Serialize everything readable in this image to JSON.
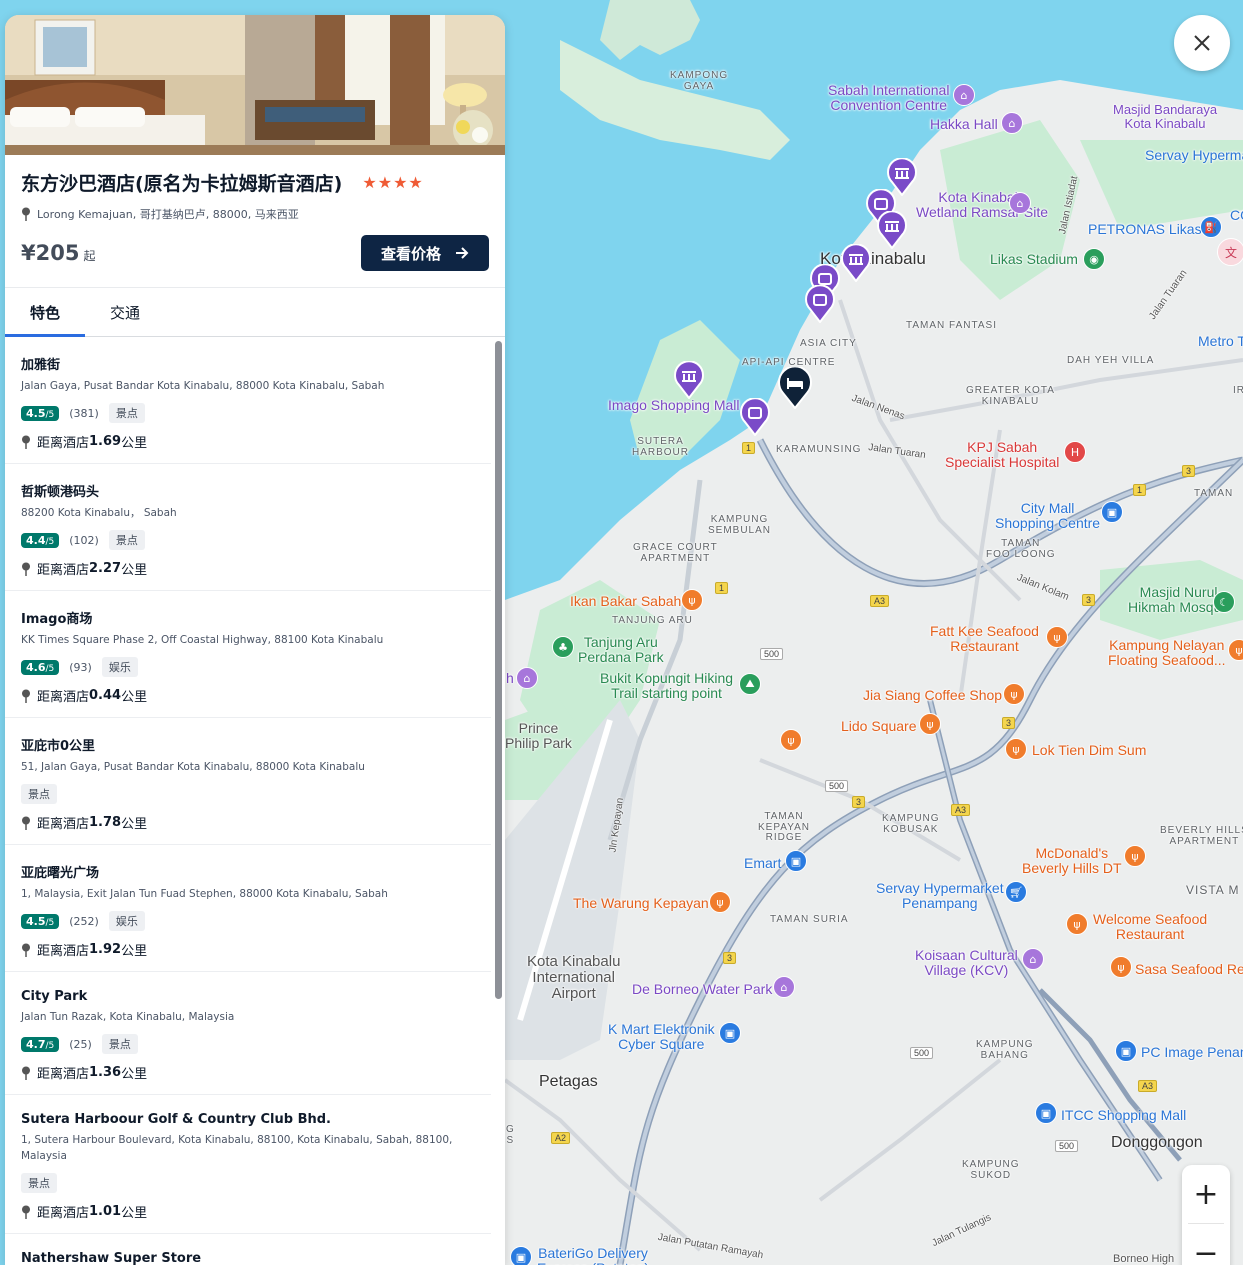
{
  "hotel": {
    "name": "东方沙巴酒店(原名为卡拉姆斯音酒店)",
    "stars": "★★★★",
    "address": "Lorong Kemajuan, 哥打基纳巴卢, 88000, 马来西亚",
    "price": "¥205",
    "price_suffix": "起",
    "check_price_label": "查看价格"
  },
  "tabs": [
    {
      "label": "特色",
      "active": true
    },
    {
      "label": "交通",
      "active": false
    }
  ],
  "places": [
    {
      "name": "加雅街",
      "address": "Jalan Gaya, Pusat Bandar Kota Kinabalu, 88000 Kota Kinabalu, Sabah",
      "rating": "4.5",
      "rating_sub": "/5",
      "reviews": "(381)",
      "tag": "景点",
      "distance_prefix": "距离酒店",
      "distance": "1.69",
      "distance_unit": "公里"
    },
    {
      "name": "哲斯顿港码头",
      "address": "88200 Kota Kinabalu， Sabah",
      "rating": "4.4",
      "rating_sub": "/5",
      "reviews": "(102)",
      "tag": "景点",
      "distance_prefix": "距离酒店",
      "distance": "2.27",
      "distance_unit": "公里"
    },
    {
      "name": "Imago商场",
      "address": "KK Times Square Phase 2, Off Coastal Highway, 88100 Kota Kinabalu",
      "rating": "4.6",
      "rating_sub": "/5",
      "reviews": "(93)",
      "tag": "娱乐",
      "distance_prefix": "距离酒店",
      "distance": "0.44",
      "distance_unit": "公里"
    },
    {
      "name": "亚庇市0公里",
      "address": "51, Jalan Gaya, Pusat Bandar Kota Kinabalu, 88000 Kota Kinabalu",
      "rating": null,
      "rating_sub": null,
      "reviews": null,
      "tag": "景点",
      "distance_prefix": "距离酒店",
      "distance": "1.78",
      "distance_unit": "公里"
    },
    {
      "name": "亚庇曙光广场",
      "address": "1, Malaysia, Exit Jalan Tun Fuad Stephen, 88000 Kota Kinabalu, Sabah",
      "rating": "4.5",
      "rating_sub": "/5",
      "reviews": "(252)",
      "tag": "娱乐",
      "distance_prefix": "距离酒店",
      "distance": "1.92",
      "distance_unit": "公里"
    },
    {
      "name": "City Park",
      "address": "Jalan Tun Razak, Kota Kinabalu, Malaysia",
      "rating": "4.7",
      "rating_sub": "/5",
      "reviews": "(25)",
      "tag": "景点",
      "distance_prefix": "距离酒店",
      "distance": "1.36",
      "distance_unit": "公里"
    },
    {
      "name": "Sutera Harboour Golf & Country Club Bhd.",
      "address": "1, Sutera Harbour Boulevard, Kota Kinabalu, 88100, Kota Kinabalu, Sabah, 88100, Malaysia",
      "rating": null,
      "rating_sub": null,
      "reviews": null,
      "tag": "景点",
      "distance_prefix": "距离酒店",
      "distance": "1.01",
      "distance_unit": "公里"
    },
    {
      "name": "Nathershaw Super Store",
      "address": "",
      "rating": null,
      "rating_sub": null,
      "reviews": null,
      "tag": null,
      "distance_prefix": null,
      "distance": null,
      "distance_unit": null
    }
  ],
  "map": {
    "labels": {
      "kampong_gaya": "KAMPONG\nGAYA",
      "sicc": "Sabah International\nConvention Centre",
      "hakka_hall": "Hakka Hall",
      "masjid_bandaraya": "Masjid Bandaraya\nKota Kinabalu",
      "servay_hyper_top": "Servay Hyperma",
      "kk_wetland": "Kota Kinabalu\nWetland Ramsar Site",
      "jalan_istiadat": "Jalan Istiadat",
      "petronas": "PETRONAS Likas",
      "co": "CO",
      "kota_kinabalu": "Kota Kinabalu",
      "likas_stadium": "Likas Stadium",
      "jalan_tuaran_top": "Jalan Tuaran",
      "taman_fantasi": "TAMAN FANTASI",
      "metro": "Metro T",
      "asia_city": "ASIA CITY",
      "api_api": "API-API CENTRE",
      "dah_yeh_villa": "DAH YEH VILLA",
      "imago": "Imago Shopping Mall",
      "jalan_nenas": "Jalan Nenas",
      "greater_kk": "GREATER KOTA\nKINABALU",
      "ir": "IR",
      "sutera_harbour": "SUTERA\nHARBOUR",
      "karamunsing": "KARAMUNSING",
      "jalan_tuaran": "Jalan Tuaran",
      "kpj": "KPJ Sabah\nSpecialist Hospital",
      "taman": "TAMAN",
      "city_mall": "City Mall\nShopping Centre",
      "kampung_sembulan": "KAMPUNG\nSEMBULAN",
      "grace_court": "GRACE COURT\nAPARTMENT",
      "taman_foo_loong": "TAMAN\nFOO LOONG",
      "jalan_kolam": "Jalan Kolam",
      "ikan_bakar": "Ikan Bakar Sabah",
      "tanjung_aru": "TANJUNG ARU",
      "masjid_nurul": "Masjid Nurul\nHikmah Mosque",
      "tanjung_aru_park": "Tanjung Aru\nPerdana Park",
      "fatt_kee": "Fatt Kee Seafood\nRestaurant",
      "kampung_nelayan": "Kampung Nelayan\nFloating Seafood...",
      "bukit_kopungit": "Bukit Kopungit Hiking\nTrail starting point",
      "jia_siang": "Jia Siang Coffee Shop",
      "prince_philip": "Prince\nPhilip Park",
      "lido_square": "Lido Square",
      "lok_tien": "Lok Tien Dim Sum",
      "jln_kepayan": "Jln Kepayan",
      "taman_kepayan": "TAMAN\nKEPAYAN\nRIDGE",
      "kampung_kobusak": "KAMPUNG\nKOBUSAK",
      "beverly_hills_apt": "BEVERLY HILLS\nAPARTMENT",
      "mcdonalds": "McDonald's\nBeverly Hills DT",
      "emart": "Emart",
      "servay_penampang": "Servay Hypermarket\nPenampang",
      "vista_m": "VISTA M",
      "warung": "The Warung Kepayan",
      "taman_suria": "TAMAN SURIA",
      "welcome_seafood": "Welcome Seafood\nRestaurant",
      "kk_airport": "Kota Kinabalu\nInternational\nAirport",
      "koisaan": "Koisaan Cultural\nVillage (KCV)",
      "sasa": "Sasa Seafood Res",
      "de_borneo": "De Borneo Water Park",
      "kmart": "K Mart Elektronik\nCyber Square",
      "kampung_bahang": "KAMPUNG\nBAHANG",
      "pc_image": "PC Image Penam",
      "petagas": "Petagas",
      "itcc": "ITCC Shopping Mall",
      "donggongon": "Donggongon",
      "kampung_sukod": "KAMPUNG\nSUKOD",
      "jalan_tulangis": "Jalan Tulangis",
      "jalan_putatan": "Jalan Putatan Ramayah",
      "baterigo": "BateriGo Delivery\nExpress (Putatan)",
      "borneo_high": "Borneo High",
      "h": "h",
      "g": "G\nS"
    },
    "shields": [
      "1",
      "1",
      "1",
      "A3",
      "500",
      "500",
      "500",
      "3",
      "3",
      "3",
      "3",
      "A3",
      "A3",
      "A2",
      "500",
      "500",
      "3"
    ],
    "zoom_in": "+",
    "zoom_out": "−"
  }
}
